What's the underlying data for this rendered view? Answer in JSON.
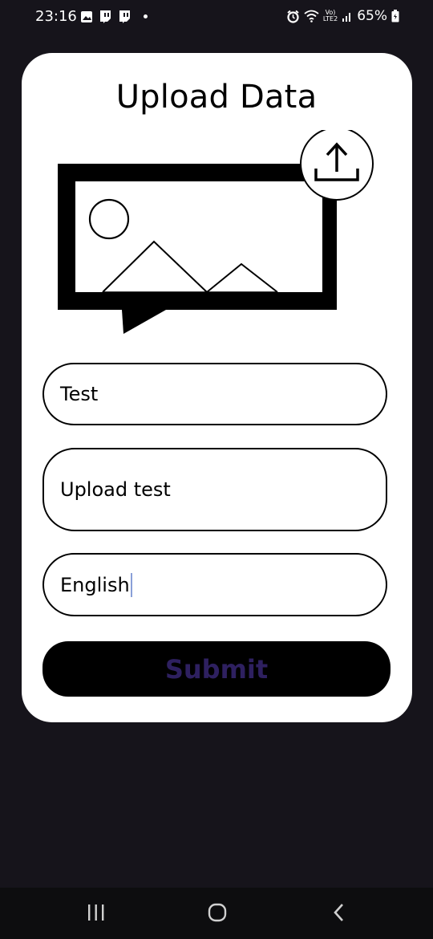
{
  "status_bar": {
    "time": "23:16",
    "battery": "65%",
    "volte": "Vo)\nLTE2",
    "notification_icons": [
      "gallery-icon",
      "twitch-icon",
      "twitch-icon"
    ],
    "system_icons": [
      "alarm-icon",
      "wifi-icon",
      "signal-icon",
      "battery-icon"
    ]
  },
  "main": {
    "title": "Upload Data",
    "illustration_icons": [
      "image-message-icon",
      "upload-icon"
    ],
    "fields": {
      "title_value": "Test",
      "description_value": "Upload test",
      "language_value": "English"
    },
    "submit_label": "Submit"
  },
  "nav_bar": {
    "icons": [
      "recent-apps-icon",
      "home-icon",
      "back-icon"
    ]
  },
  "colors": {
    "background": "#16141b",
    "card": "#ffffff",
    "submit_bg": "#000000",
    "submit_text": "#2e2060",
    "caret": "#8aa0d8"
  }
}
